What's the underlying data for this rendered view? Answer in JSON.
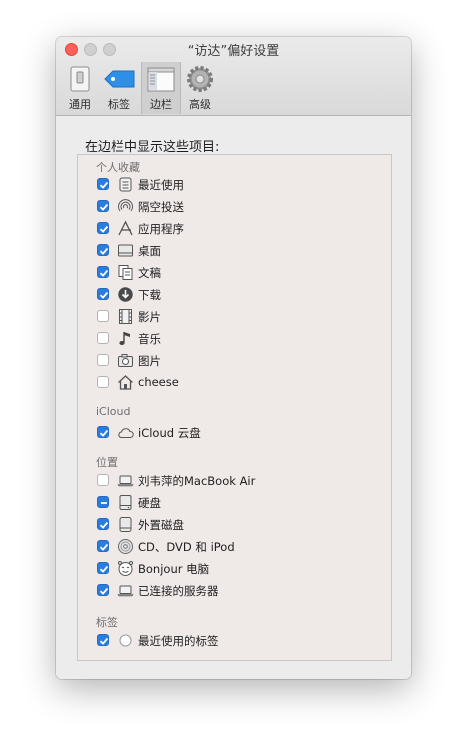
{
  "window": {
    "title": "“访达”偏好设置"
  },
  "toolbar": {
    "tabs": [
      {
        "label": "通用",
        "icon": "switch-icon"
      },
      {
        "label": "标签",
        "icon": "tag-icon"
      },
      {
        "label": "边栏",
        "icon": "sidebar-icon",
        "selected": true
      },
      {
        "label": "高级",
        "icon": "gear-icon"
      }
    ]
  },
  "content": {
    "heading": "在边栏中显示这些项目:",
    "sections": {
      "favorites": {
        "title": "个人收藏",
        "items": [
          {
            "label": "最近使用",
            "checked": true,
            "icon": "recents-icon"
          },
          {
            "label": "隔空投送",
            "checked": true,
            "icon": "airdrop-icon"
          },
          {
            "label": "应用程序",
            "checked": true,
            "icon": "applications-icon"
          },
          {
            "label": "桌面",
            "checked": true,
            "icon": "desktop-icon"
          },
          {
            "label": "文稿",
            "checked": true,
            "icon": "documents-icon"
          },
          {
            "label": "下载",
            "checked": true,
            "icon": "downloads-icon"
          },
          {
            "label": "影片",
            "checked": false,
            "icon": "movies-icon"
          },
          {
            "label": "音乐",
            "checked": false,
            "icon": "music-icon"
          },
          {
            "label": "图片",
            "checked": false,
            "icon": "pictures-icon"
          },
          {
            "label": "cheese",
            "checked": false,
            "icon": "home-icon"
          }
        ]
      },
      "icloud": {
        "title": "iCloud",
        "items": [
          {
            "label": "iCloud 云盘",
            "checked": true,
            "icon": "cloud-icon"
          }
        ]
      },
      "locations": {
        "title": "位置",
        "items": [
          {
            "label": "刘韦萍的MacBook Air",
            "checked": false,
            "icon": "laptop-icon"
          },
          {
            "label": "硬盘",
            "checked": "mixed",
            "icon": "harddisk-icon"
          },
          {
            "label": "外置磁盘",
            "checked": true,
            "icon": "external-disk-icon"
          },
          {
            "label": "CD、DVD 和 iPod",
            "checked": true,
            "icon": "disc-icon"
          },
          {
            "label": "Bonjour 电脑",
            "checked": true,
            "icon": "bonjour-icon"
          },
          {
            "label": "已连接的服务器",
            "checked": true,
            "icon": "server-icon"
          }
        ]
      },
      "tags": {
        "title": "标签",
        "items": [
          {
            "label": "最近使用的标签",
            "checked": true,
            "icon": "tag-circle-icon"
          }
        ]
      }
    }
  },
  "colors": {
    "accent": "#2b7cdf",
    "close": "#fc5f57"
  }
}
